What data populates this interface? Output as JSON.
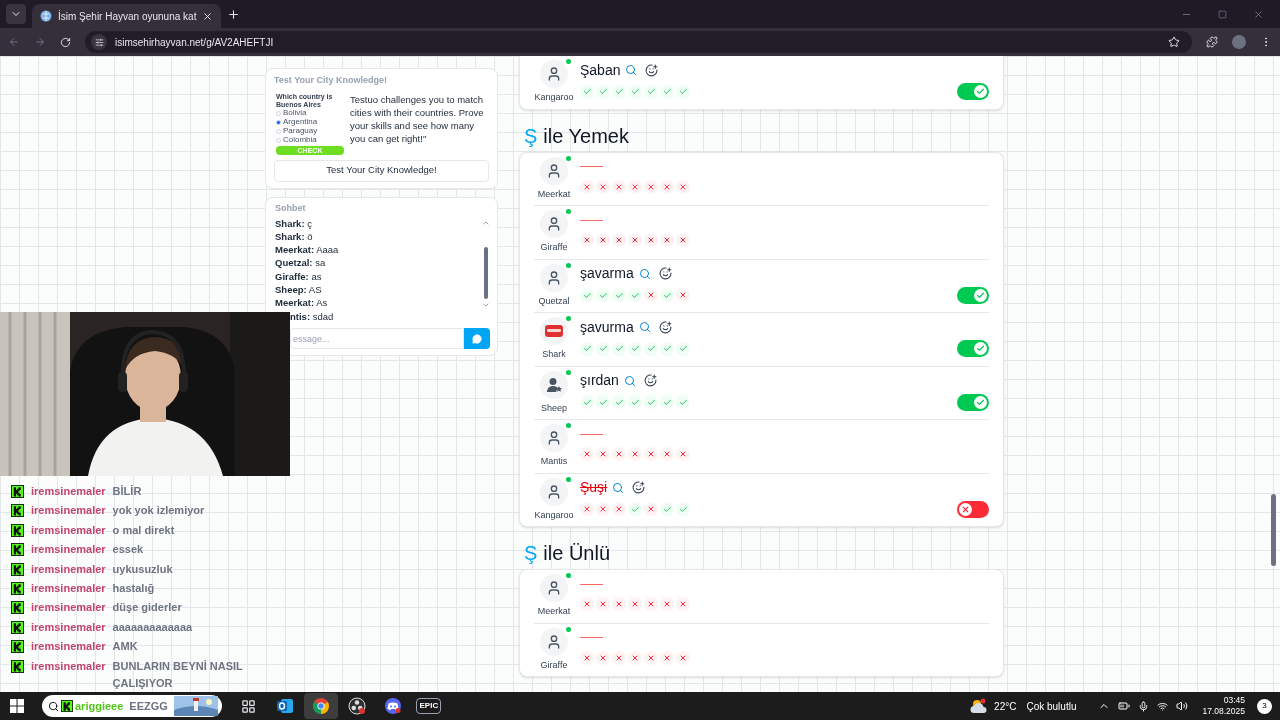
{
  "browser": {
    "tab": {
      "title": "İsim Şehir Hayvan oyununa kat",
      "selected": true
    },
    "url": "isimsehirhayvan.net/g/AV2AHEFTJI"
  },
  "quiz_card": {
    "title": "Test Your City Knowledge!",
    "ad": {
      "question": "Which country is Buenos Aires",
      "options": [
        {
          "label": "Bolivia",
          "checked": false
        },
        {
          "label": "Argentina",
          "checked": true
        },
        {
          "label": "Paraguay",
          "checked": false
        },
        {
          "label": "Colombia",
          "checked": false
        }
      ],
      "button": "CHECK"
    },
    "description": "Testuo challenges you to match cities with their countries. Prove your skills and see how many you can get right!\"",
    "button": "Test Your City Knowledge!"
  },
  "chat": {
    "title": "Sohbet",
    "messages": [
      {
        "author": "Shark:",
        "text": "ç"
      },
      {
        "author": "Shark:",
        "text": "ö"
      },
      {
        "author": "Meerkat:",
        "text": "Aaaa"
      },
      {
        "author": "Quetzal:",
        "text": "sa"
      },
      {
        "author": "Giraffe:",
        "text": "as"
      },
      {
        "author": "Sheep:",
        "text": "AS"
      },
      {
        "author": "Meerkat:",
        "text": "As"
      },
      {
        "author": "ntis:",
        "text": "sdad"
      }
    ],
    "input": {
      "placeholder": "essage..."
    }
  },
  "sections": [
    {
      "answers": [
        {
          "player": "Kangaroo",
          "avatar": {
            "kind": "default"
          },
          "online": true,
          "kind": "word",
          "answer": "Şaban",
          "votes": [
            true,
            true,
            true,
            true,
            true,
            true,
            true
          ],
          "accepted": true
        }
      ]
    },
    {
      "letter": "Ş",
      "title": "ile Yemek",
      "answers": [
        {
          "player": "Meerkat",
          "avatar": {
            "kind": "default"
          },
          "online": true,
          "kind": "empty",
          "votes": [
            false,
            false,
            false,
            false,
            false,
            false,
            false
          ]
        },
        {
          "player": "Giraffe",
          "avatar": {
            "kind": "default"
          },
          "online": true,
          "kind": "empty",
          "votes": [
            false,
            false,
            false,
            false,
            false,
            false,
            false
          ]
        },
        {
          "player": "Quetzal",
          "avatar": {
            "kind": "default"
          },
          "online": true,
          "kind": "word",
          "answer": "şavarma",
          "votes": [
            true,
            true,
            true,
            true,
            false,
            true,
            false
          ],
          "accepted": true
        },
        {
          "player": "Shark",
          "avatar": {
            "kind": "stop"
          },
          "online": true,
          "kind": "word",
          "answer": "şavurma",
          "votes": [
            true,
            true,
            true,
            true,
            true,
            true,
            true
          ],
          "accepted": true
        },
        {
          "player": "Sheep",
          "avatar": {
            "kind": "star"
          },
          "online": true,
          "kind": "word",
          "answer": "şırdan",
          "votes": [
            true,
            true,
            true,
            true,
            true,
            true,
            true
          ],
          "accepted": true
        },
        {
          "player": "Mantis",
          "avatar": {
            "kind": "default"
          },
          "online": true,
          "kind": "empty",
          "votes": [
            false,
            false,
            false,
            false,
            false,
            false,
            false
          ]
        },
        {
          "player": "Kangaroo",
          "avatar": {
            "kind": "default"
          },
          "online": true,
          "kind": "word",
          "answer": "Şuşi",
          "votes": [
            false,
            false,
            false,
            true,
            false,
            true,
            true
          ],
          "accepted": false
        }
      ]
    },
    {
      "letter": "Ş",
      "title": "ile Ünlü",
      "answers": [
        {
          "player": "Meerkat",
          "avatar": {
            "kind": "default"
          },
          "online": true,
          "kind": "empty",
          "votes": [
            false,
            false,
            false,
            false,
            false,
            false,
            false
          ]
        },
        {
          "player": "Giraffe",
          "avatar": {
            "kind": "default"
          },
          "online": true,
          "kind": "empty",
          "votes": [
            false,
            false,
            false,
            false,
            false,
            false,
            false
          ]
        }
      ]
    }
  ],
  "stream_overlay": {
    "chat": [
      {
        "user": "iremsinemaler",
        "message": "BİLİR"
      },
      {
        "user": "iremsinemaler",
        "message": "yok yok izlemiyor"
      },
      {
        "user": "iremsinemaler",
        "message": "o mal direkt"
      },
      {
        "user": "iremsinemaler",
        "message": "essek"
      },
      {
        "user": "iremsinemaler",
        "message": "uykusuzluk"
      },
      {
        "user": "iremsinemaler",
        "message": "hastalığ"
      },
      {
        "user": "iremsinemaler",
        "message": "düşe giderler"
      },
      {
        "user": "iremsinemaler",
        "message": "aaaaaaaaaaaaa"
      },
      {
        "user": "iremsinemaler",
        "message": "AMK"
      },
      {
        "user": "iremsinemaler",
        "message": "BUNLARIN BEYNİ NASIL ÇALIŞIYOR"
      }
    ]
  },
  "taskbar": {
    "stream_widget": {
      "label": "ariggieee",
      "suffix": "EEZGG"
    },
    "apps": [
      {
        "kind": "taskview",
        "selected": false
      },
      {
        "kind": "outlook",
        "selected": false
      },
      {
        "kind": "chrome",
        "selected": true
      },
      {
        "kind": "obs",
        "selected": false
      },
      {
        "kind": "discord",
        "selected": false
      },
      {
        "kind": "epic",
        "label": "EPIC",
        "selected": false
      }
    ],
    "weather": {
      "temp": "22°C",
      "text": "Çok bulutlu"
    },
    "clock": {
      "time": "03:45",
      "date": "17.08.2025"
    },
    "notifications": "3"
  }
}
